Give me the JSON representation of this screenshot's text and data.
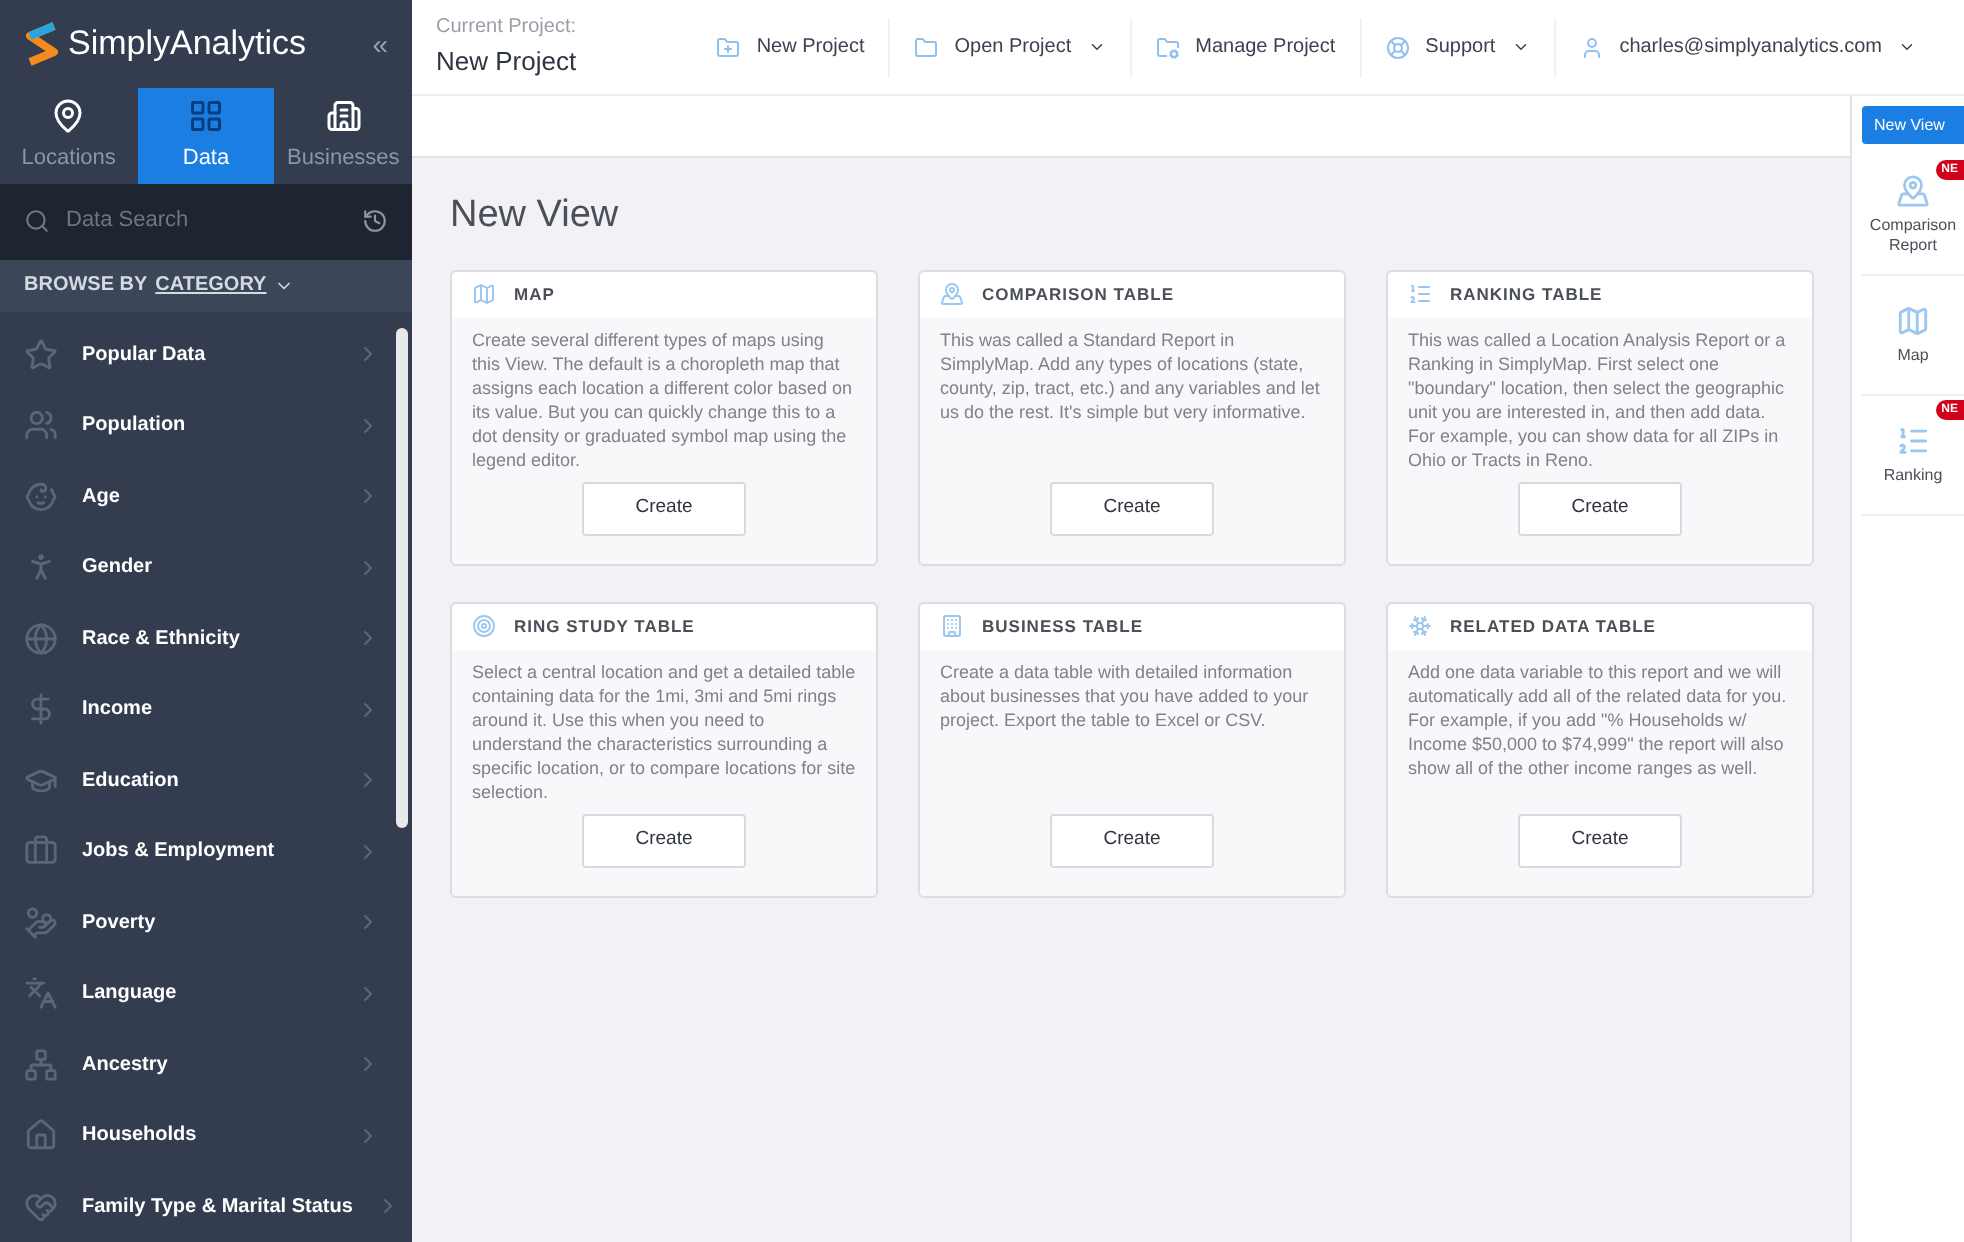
{
  "brand": {
    "name": "SimplyAnalytics",
    "collapse": "«"
  },
  "nav_tabs": [
    {
      "label": "Locations",
      "kind": "pin",
      "selected": false
    },
    {
      "label": "Data",
      "kind": "grid",
      "selected": true
    },
    {
      "label": "Businesses",
      "kind": "building",
      "selected": false
    }
  ],
  "search": {
    "placeholder": "Data Search"
  },
  "browse": {
    "prefix": "BROWSE BY",
    "mode": "CATEGORY"
  },
  "categories": [
    {
      "label": "Popular Data",
      "kind": "popular"
    },
    {
      "label": "Population",
      "kind": "population"
    },
    {
      "label": "Age",
      "kind": "age"
    },
    {
      "label": "Gender",
      "kind": "gender"
    },
    {
      "label": "Race & Ethnicity",
      "kind": "race"
    },
    {
      "label": "Income",
      "kind": "income"
    },
    {
      "label": "Education",
      "kind": "education"
    },
    {
      "label": "Jobs & Employment",
      "kind": "jobs"
    },
    {
      "label": "Poverty",
      "kind": "poverty"
    },
    {
      "label": "Language",
      "kind": "language"
    },
    {
      "label": "Ancestry",
      "kind": "ancestry"
    },
    {
      "label": "Households",
      "kind": "households"
    },
    {
      "label": "Family Type & Marital Status",
      "kind": "family"
    }
  ],
  "project": {
    "caption": "Current Project:",
    "name": "New Project"
  },
  "top_menu": [
    {
      "label": "New Project",
      "kind": "new",
      "dropdown": false
    },
    {
      "label": "Open Project",
      "kind": "open",
      "dropdown": true
    },
    {
      "label": "Manage Project",
      "kind": "manage",
      "dropdown": false
    },
    {
      "label": "Support",
      "kind": "support",
      "dropdown": true
    },
    {
      "label": "charles@simplyanalytics.com",
      "kind": "user",
      "dropdown": true
    }
  ],
  "page_title": "New View",
  "cards": [
    {
      "title": "MAP",
      "kind": "map",
      "text": "Create several different types of maps using this View. The default is a choropleth map that assigns each location a different color based on its value. But you can quickly change this to a dot density or graduated symbol map using the legend editor.",
      "button": "Create"
    },
    {
      "title": "COMPARISON TABLE",
      "kind": "comparison",
      "text": "This was called a Standard Report in SimplyMap. Add any types of locations (state, county, zip, tract, etc.) and any variables and let us do the rest. It's simple but very informative.",
      "button": "Create"
    },
    {
      "title": "RANKING TABLE",
      "kind": "ranking",
      "text": "This was called a Location Analysis Report or a Ranking in SimplyMap. First select one \"boundary\" location, then select the geographic unit you are interested in, and then add data. For example, you can show data for all ZIPs in Ohio or Tracts in Reno.",
      "button": "Create"
    },
    {
      "title": "RING STUDY TABLE",
      "kind": "ring",
      "text": "Select a central location and get a detailed table containing data for the 1mi, 3mi and 5mi rings around it. Use this when you need to understand the characteristics surrounding a specific location, or to compare locations for site selection.",
      "button": "Create"
    },
    {
      "title": "BUSINESS TABLE",
      "kind": "business",
      "text": "Create a data table with detailed information about businesses that you have added to your project. Export the table to Excel or CSV.",
      "button": "Create"
    },
    {
      "title": "RELATED DATA TABLE",
      "kind": "related",
      "text": "Add one data variable to this report and we will automatically add all of the related data for you. For example, if you add \"% Households w/ Income $50,000 to $74,999\" the report will also show all of the other income ranges as well.",
      "button": "Create"
    }
  ],
  "new_view_button": "New View",
  "views": [
    {
      "label": "Comparison Report",
      "kind": "comparison",
      "badge": "NE"
    },
    {
      "label": "Map",
      "kind": "map"
    },
    {
      "label": "Ranking",
      "kind": "ranking",
      "badge": "NE"
    }
  ]
}
